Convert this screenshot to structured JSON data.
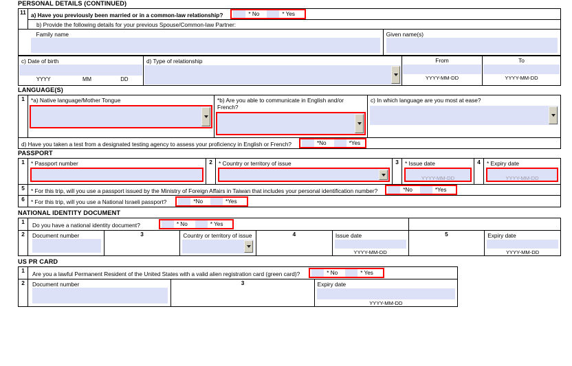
{
  "sections": {
    "personal_details": {
      "title": "PERSONAL DETAILS (CONTINUED)",
      "q11_num": "11",
      "q11a_label": "a) Have you previously been married or in a common-law relationship?",
      "q11a_no": "* No",
      "q11a_yes": "* Yes",
      "q11b_label": "b) Provide the following details for your previous Spouse/Common-law Partner:",
      "family_name_label": "Family name",
      "given_names_label": "Given name(s)",
      "dob_label": "c) Date of birth",
      "dob_yyyy": "YYYY",
      "dob_mm": "MM",
      "dob_dd": "DD",
      "relationship_label": "d) Type of relationship",
      "from_label": "From",
      "to_label": "To",
      "from_hint": "YYYY-MM-DD",
      "to_hint": "YYYY-MM-DD"
    },
    "languages": {
      "title": "LANGUAGE(S)",
      "num": "1",
      "a_label": "*a) Native language/Mother Tongue",
      "b_label": "*b) Are you able to communicate in English and/or French?",
      "c_label": "c) In which language are you most at ease?",
      "d_label": "d) Have you taken a test from a designated testing agency to assess your proficiency in English or French?",
      "d_no": "*No",
      "d_yes": "*Yes"
    },
    "passport": {
      "title": "PASSPORT",
      "q1_num": "1",
      "q1_label": "* Passport number",
      "q2_num": "2",
      "q2_label": "* Country or territory of issue",
      "q3_num": "3",
      "q3_label": "* Issue date",
      "q3_hint": "YYYY-MM-DD",
      "q4_num": "4",
      "q4_label": "* Expiry date",
      "q4_hint": "YYYY-MM-DD",
      "q5_num": "5",
      "q5_label": "* For this trip, will you use a passport issued by the Ministry of Foreign Affairs in Taiwan that includes your personal identification number?",
      "q5_no": "*No",
      "q5_yes": "*Yes",
      "q6_num": "6",
      "q6_label": "* For this trip, will you use a National Israeli passport?",
      "q6_no": "*No",
      "q6_yes": "*Yes"
    },
    "national_id": {
      "title": "NATIONAL IDENTITY DOCUMENT",
      "q1_num": "1",
      "q1_label": "Do you have a national identity document?",
      "q1_no": "* No",
      "q1_yes": "* Yes",
      "q2_num": "2",
      "q2_label": "Document number",
      "q3_num": "3",
      "q3_label": "Country or territory of issue",
      "q4_num": "4",
      "q4_label": "Issue date",
      "q4_hint": "YYYY-MM-DD",
      "q5_num": "5",
      "q5_label": "Expiry date",
      "q5_hint": "YYYY-MM-DD"
    },
    "us_pr_card": {
      "title": "US PR CARD",
      "q1_num": "1",
      "q1_label": "Are you a lawful Permanent Resident of the United States with a valid alien registration card (green card)?",
      "q1_no": "* No",
      "q1_yes": "* Yes",
      "q2_num": "2",
      "q2_label": "Document number",
      "q3_num": "3",
      "q3_label": "Expiry date",
      "q3_hint": "YYYY-MM-DD"
    }
  },
  "colors": {
    "field_fill": "#dde1f7",
    "error_border": "#fe0000",
    "dropdown_button": "#d6d3c4",
    "hint_text_red_field": "#a09aa8"
  }
}
